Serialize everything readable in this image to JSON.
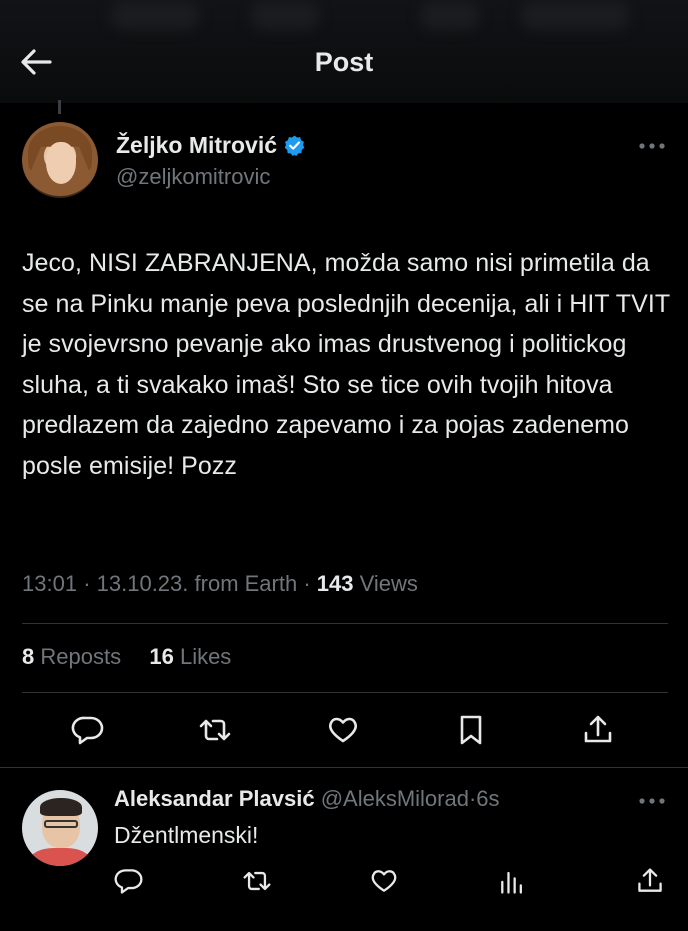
{
  "header": {
    "title": "Post"
  },
  "tweet": {
    "author_name": "Željko Mitrović",
    "author_handle": "@zeljkomitrovic",
    "text": "Jeco, NISI ZABRANJENA, možda samo nisi primetila da se na Pinku manje peva poslednjih decenija, ali i HIT TVIT je svojevrsno pevanje ako imas drustvenog i politickog sluha, a ti svakako imaš! Sto se tice ovih tvojih hitova predlazem da zajedno zapevamo i za pojas zadenemo posle emisije! Pozz",
    "time": "13:01",
    "date": "13.10.23.",
    "source": "from Earth",
    "views_count": "143",
    "views_label": "Views",
    "reposts_count": "8",
    "reposts_label": "Reposts",
    "likes_count": "16",
    "likes_label": "Likes"
  },
  "reply": {
    "author_name": "Aleksandar Plavsić",
    "author_handle": "@AleksMilorad",
    "time": "6s",
    "text": "Džentlmenski!"
  },
  "icons": {
    "back": "arrow-left-icon",
    "verified": "verified-badge-icon",
    "more": "more-horizontal-icon",
    "reply": "comment-icon",
    "repost": "repost-icon",
    "like": "heart-icon",
    "bookmark": "bookmark-icon",
    "share": "share-icon",
    "analytics": "analytics-icon"
  },
  "colors": {
    "background": "#000000",
    "text_primary": "#e7e9ea",
    "text_secondary": "#71767b",
    "verified_blue": "#1d9bf0",
    "divider": "#2f3336"
  }
}
